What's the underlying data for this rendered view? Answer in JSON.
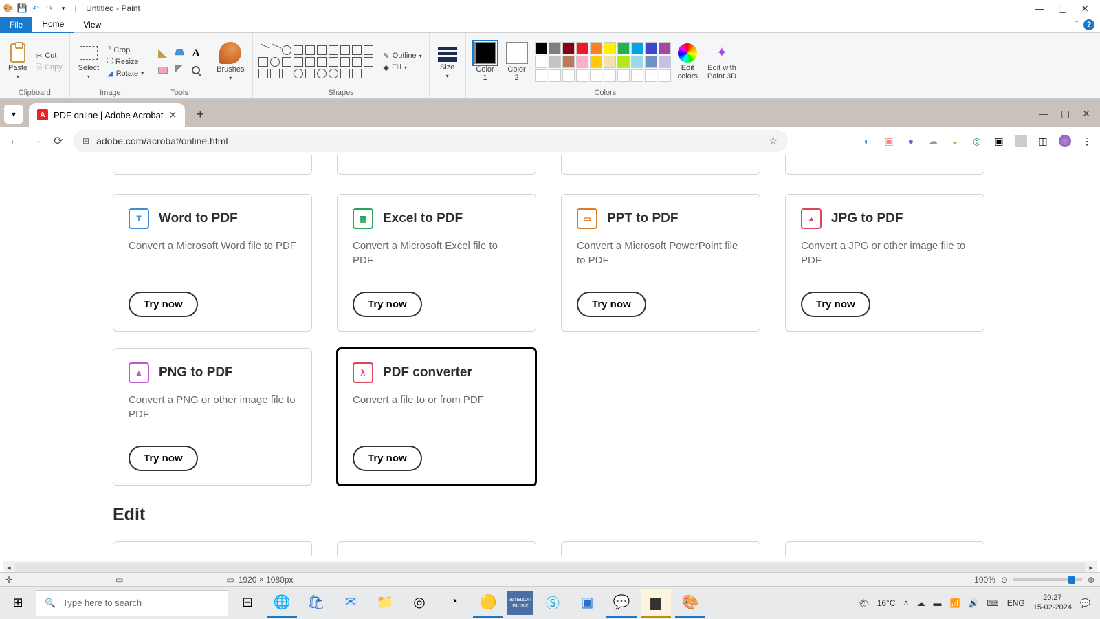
{
  "titleBar": {
    "title": "Untitled - Paint"
  },
  "ribbonTabs": {
    "file": "File",
    "home": "Home",
    "view": "View"
  },
  "ribbon": {
    "clipboard": {
      "paste": "Paste",
      "cut": "Cut",
      "copy": "Copy",
      "label": "Clipboard"
    },
    "image": {
      "select": "Select",
      "crop": "Crop",
      "resize": "Resize",
      "rotate": "Rotate",
      "label": "Image"
    },
    "tools": {
      "label": "Tools"
    },
    "brushes": {
      "label": "Brushes"
    },
    "shapes": {
      "outline": "Outline",
      "fill": "Fill",
      "label": "Shapes"
    },
    "size": {
      "label": "Size"
    },
    "colors": {
      "color1": "Color\n1",
      "color2": "Color\n2",
      "editColors": "Edit\ncolors",
      "editPaint3d": "Edit with\nPaint 3D",
      "label": "Colors",
      "row1": [
        "#000000",
        "#7f7f7f",
        "#880015",
        "#ed1c24",
        "#ff7f27",
        "#fff200",
        "#22b14c",
        "#00a2e8",
        "#3f48cc",
        "#a349a4"
      ],
      "row2": [
        "#ffffff",
        "#c3c3c3",
        "#b97a57",
        "#ffaec9",
        "#ffc90e",
        "#efe4b0",
        "#b5e61d",
        "#99d9ea",
        "#7092be",
        "#c8bfe7"
      ],
      "row3": [
        "#ffffff",
        "#ffffff",
        "#ffffff",
        "#ffffff",
        "#ffffff",
        "#ffffff",
        "#ffffff",
        "#ffffff",
        "#ffffff",
        "#ffffff"
      ]
    }
  },
  "browser": {
    "tabTitle": "PDF online | Adobe Acrobat",
    "url": "adobe.com/acrobat/online.html"
  },
  "page": {
    "cards": [
      {
        "title": "Word to PDF",
        "desc": "Convert a Microsoft Word file to PDF",
        "btn": "Try now",
        "color": "#3a8dd9",
        "iconLetter": "T"
      },
      {
        "title": "Excel to PDF",
        "desc": "Convert a Microsoft Excel file to PDF",
        "btn": "Try now",
        "color": "#2aa35a",
        "iconLetter": "▦"
      },
      {
        "title": "PPT to PDF",
        "desc": "Convert a Microsoft PowerPoint file to PDF",
        "btn": "Try now",
        "color": "#d97c2e",
        "iconLetter": "▭"
      },
      {
        "title": "JPG to PDF",
        "desc": "Convert a JPG or other image file to PDF",
        "btn": "Try now",
        "color": "#d9455a",
        "iconLetter": "▲"
      }
    ],
    "cards2": [
      {
        "title": "PNG to PDF",
        "desc": "Convert a PNG or other image file to PDF",
        "btn": "Try now",
        "color": "#c056d9",
        "iconLetter": "▲"
      },
      {
        "title": "PDF converter",
        "desc": "Convert a file to or from PDF",
        "btn": "Try now",
        "color": "#d9455a",
        "iconLetter": "λ",
        "highlight": true
      }
    ],
    "editHeading": "Edit"
  },
  "status": {
    "canvasSize": "1920 × 1080px",
    "zoom": "100%"
  },
  "taskbar": {
    "searchPlaceholder": "Type here to search",
    "weather": "16°C",
    "lang": "ENG",
    "time": "20:27",
    "date": "15-02-2024"
  }
}
